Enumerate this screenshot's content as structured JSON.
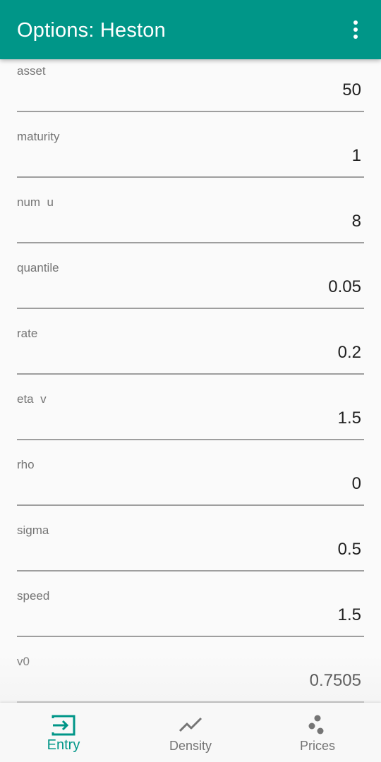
{
  "appbar": {
    "title": "Options: Heston",
    "overflow_icon": "more-vert-icon"
  },
  "fields": [
    {
      "id": "asset",
      "label": "asset",
      "value": "50"
    },
    {
      "id": "maturity",
      "label": "maturity",
      "value": "1"
    },
    {
      "id": "num-u",
      "label": "num  u",
      "value": "8"
    },
    {
      "id": "quantile",
      "label": "quantile",
      "value": "0.05"
    },
    {
      "id": "rate",
      "label": "rate",
      "value": "0.2"
    },
    {
      "id": "eta-v",
      "label": "eta  v",
      "value": "1.5"
    },
    {
      "id": "rho",
      "label": "rho",
      "value": "0"
    },
    {
      "id": "sigma",
      "label": "sigma",
      "value": "0.5"
    },
    {
      "id": "speed",
      "label": "speed",
      "value": "1.5"
    },
    {
      "id": "v0",
      "label": "v0",
      "value": "0.7505"
    }
  ],
  "bottom_nav": {
    "items": [
      {
        "label": "Entry",
        "icon": "input-icon",
        "active": true
      },
      {
        "label": "Density",
        "icon": "show-chart-icon",
        "active": false
      },
      {
        "label": "Prices",
        "icon": "scatter-dots-icon",
        "active": false
      }
    ]
  },
  "colors": {
    "primary": "#009688",
    "inactive": "#757575",
    "text": "#212121",
    "underline": "#9e9e9e",
    "background": "#fafafa"
  }
}
